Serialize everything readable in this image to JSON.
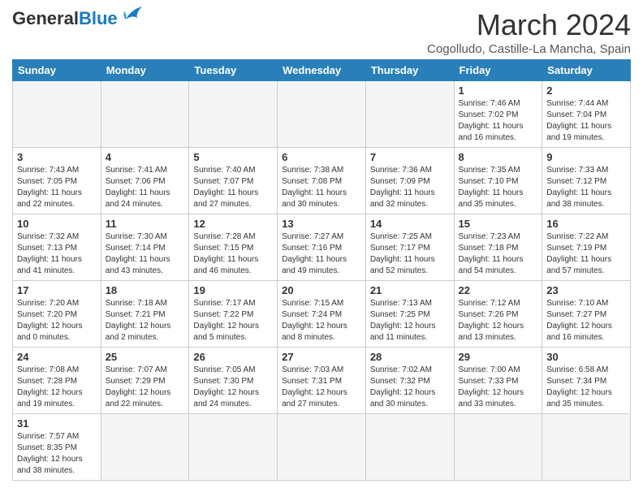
{
  "header": {
    "logo_general": "General",
    "logo_blue": "Blue",
    "month_title": "March 2024",
    "subtitle": "Cogolludo, Castille-La Mancha, Spain"
  },
  "calendar": {
    "days_of_week": [
      "Sunday",
      "Monday",
      "Tuesday",
      "Wednesday",
      "Thursday",
      "Friday",
      "Saturday"
    ],
    "weeks": [
      [
        {
          "day": "",
          "info": ""
        },
        {
          "day": "",
          "info": ""
        },
        {
          "day": "",
          "info": ""
        },
        {
          "day": "",
          "info": ""
        },
        {
          "day": "",
          "info": ""
        },
        {
          "day": "1",
          "info": "Sunrise: 7:46 AM\nSunset: 7:02 PM\nDaylight: 11 hours and 16 minutes."
        },
        {
          "day": "2",
          "info": "Sunrise: 7:44 AM\nSunset: 7:04 PM\nDaylight: 11 hours and 19 minutes."
        }
      ],
      [
        {
          "day": "3",
          "info": "Sunrise: 7:43 AM\nSunset: 7:05 PM\nDaylight: 11 hours and 22 minutes."
        },
        {
          "day": "4",
          "info": "Sunrise: 7:41 AM\nSunset: 7:06 PM\nDaylight: 11 hours and 24 minutes."
        },
        {
          "day": "5",
          "info": "Sunrise: 7:40 AM\nSunset: 7:07 PM\nDaylight: 11 hours and 27 minutes."
        },
        {
          "day": "6",
          "info": "Sunrise: 7:38 AM\nSunset: 7:08 PM\nDaylight: 11 hours and 30 minutes."
        },
        {
          "day": "7",
          "info": "Sunrise: 7:36 AM\nSunset: 7:09 PM\nDaylight: 11 hours and 32 minutes."
        },
        {
          "day": "8",
          "info": "Sunrise: 7:35 AM\nSunset: 7:10 PM\nDaylight: 11 hours and 35 minutes."
        },
        {
          "day": "9",
          "info": "Sunrise: 7:33 AM\nSunset: 7:12 PM\nDaylight: 11 hours and 38 minutes."
        }
      ],
      [
        {
          "day": "10",
          "info": "Sunrise: 7:32 AM\nSunset: 7:13 PM\nDaylight: 11 hours and 41 minutes."
        },
        {
          "day": "11",
          "info": "Sunrise: 7:30 AM\nSunset: 7:14 PM\nDaylight: 11 hours and 43 minutes."
        },
        {
          "day": "12",
          "info": "Sunrise: 7:28 AM\nSunset: 7:15 PM\nDaylight: 11 hours and 46 minutes."
        },
        {
          "day": "13",
          "info": "Sunrise: 7:27 AM\nSunset: 7:16 PM\nDaylight: 11 hours and 49 minutes."
        },
        {
          "day": "14",
          "info": "Sunrise: 7:25 AM\nSunset: 7:17 PM\nDaylight: 11 hours and 52 minutes."
        },
        {
          "day": "15",
          "info": "Sunrise: 7:23 AM\nSunset: 7:18 PM\nDaylight: 11 hours and 54 minutes."
        },
        {
          "day": "16",
          "info": "Sunrise: 7:22 AM\nSunset: 7:19 PM\nDaylight: 11 hours and 57 minutes."
        }
      ],
      [
        {
          "day": "17",
          "info": "Sunrise: 7:20 AM\nSunset: 7:20 PM\nDaylight: 12 hours and 0 minutes."
        },
        {
          "day": "18",
          "info": "Sunrise: 7:18 AM\nSunset: 7:21 PM\nDaylight: 12 hours and 2 minutes."
        },
        {
          "day": "19",
          "info": "Sunrise: 7:17 AM\nSunset: 7:22 PM\nDaylight: 12 hours and 5 minutes."
        },
        {
          "day": "20",
          "info": "Sunrise: 7:15 AM\nSunset: 7:24 PM\nDaylight: 12 hours and 8 minutes."
        },
        {
          "day": "21",
          "info": "Sunrise: 7:13 AM\nSunset: 7:25 PM\nDaylight: 12 hours and 11 minutes."
        },
        {
          "day": "22",
          "info": "Sunrise: 7:12 AM\nSunset: 7:26 PM\nDaylight: 12 hours and 13 minutes."
        },
        {
          "day": "23",
          "info": "Sunrise: 7:10 AM\nSunset: 7:27 PM\nDaylight: 12 hours and 16 minutes."
        }
      ],
      [
        {
          "day": "24",
          "info": "Sunrise: 7:08 AM\nSunset: 7:28 PM\nDaylight: 12 hours and 19 minutes."
        },
        {
          "day": "25",
          "info": "Sunrise: 7:07 AM\nSunset: 7:29 PM\nDaylight: 12 hours and 22 minutes."
        },
        {
          "day": "26",
          "info": "Sunrise: 7:05 AM\nSunset: 7:30 PM\nDaylight: 12 hours and 24 minutes."
        },
        {
          "day": "27",
          "info": "Sunrise: 7:03 AM\nSunset: 7:31 PM\nDaylight: 12 hours and 27 minutes."
        },
        {
          "day": "28",
          "info": "Sunrise: 7:02 AM\nSunset: 7:32 PM\nDaylight: 12 hours and 30 minutes."
        },
        {
          "day": "29",
          "info": "Sunrise: 7:00 AM\nSunset: 7:33 PM\nDaylight: 12 hours and 33 minutes."
        },
        {
          "day": "30",
          "info": "Sunrise: 6:58 AM\nSunset: 7:34 PM\nDaylight: 12 hours and 35 minutes."
        }
      ],
      [
        {
          "day": "31",
          "info": "Sunrise: 7:57 AM\nSunset: 8:35 PM\nDaylight: 12 hours and 38 minutes."
        },
        {
          "day": "",
          "info": ""
        },
        {
          "day": "",
          "info": ""
        },
        {
          "day": "",
          "info": ""
        },
        {
          "day": "",
          "info": ""
        },
        {
          "day": "",
          "info": ""
        },
        {
          "day": "",
          "info": ""
        }
      ]
    ]
  }
}
